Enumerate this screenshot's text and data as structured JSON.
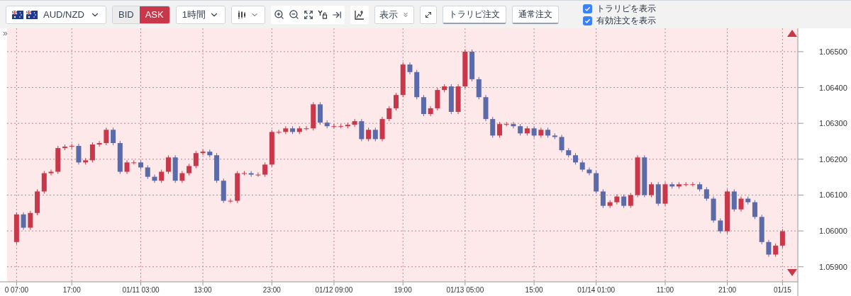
{
  "toolbar": {
    "symbol": {
      "label": "AUD/NZD"
    },
    "price_side": [
      {
        "label": "BID",
        "selected": false
      },
      {
        "label": "ASK",
        "selected": true
      }
    ],
    "timeframe": {
      "label": "1時間"
    },
    "display_menu": {
      "label": "表示"
    },
    "order_buttons": [
      "トラリピ注文",
      "通常注文"
    ],
    "checkboxes": [
      {
        "label": "トラリピを表示",
        "checked": true
      },
      {
        "label": "有効注文を表示",
        "checked": true
      }
    ]
  },
  "chart": {
    "panel_toggle": "»",
    "chart_data": {
      "type": "candlestick",
      "grid": true,
      "ylim": [
        1.05858,
        1.06565
      ],
      "yticks": [
        {
          "value": 1.065,
          "label": "1.06500"
        },
        {
          "value": 1.064,
          "label": "1.06400"
        },
        {
          "value": 1.063,
          "label": "1.06300"
        },
        {
          "value": 1.062,
          "label": "1.06200"
        },
        {
          "value": 1.061,
          "label": "1.06100"
        },
        {
          "value": 1.06,
          "label": "1.06000"
        },
        {
          "value": 1.059,
          "label": "1.05900"
        }
      ],
      "categories": [
        "0 07:00",
        null,
        null,
        null,
        null,
        null,
        null,
        null,
        "17:00",
        null,
        null,
        null,
        null,
        null,
        null,
        null,
        null,
        null,
        "01/11 03:00",
        null,
        null,
        null,
        null,
        null,
        null,
        null,
        null,
        "13:00",
        null,
        null,
        null,
        null,
        null,
        null,
        null,
        null,
        null,
        "23:00",
        null,
        null,
        null,
        null,
        null,
        null,
        null,
        null,
        "01/12 09:00",
        null,
        null,
        null,
        null,
        null,
        null,
        null,
        null,
        null,
        "19:00",
        null,
        null,
        null,
        null,
        null,
        null,
        null,
        null,
        "01/13 05:00",
        null,
        null,
        null,
        null,
        null,
        null,
        null,
        null,
        null,
        "15:00",
        null,
        null,
        null,
        null,
        null,
        null,
        null,
        null,
        "01/14 01:00",
        null,
        null,
        null,
        null,
        null,
        null,
        null,
        null,
        null,
        "11:00",
        null,
        null,
        null,
        null,
        null,
        null,
        null,
        null,
        "21:00",
        null,
        null,
        null,
        null,
        null,
        null,
        null,
        "01/15"
      ],
      "ohlc": [
        [
          1.05969,
          1.06052,
          1.05963,
          1.06046
        ],
        [
          1.06046,
          1.06052,
          1.06003,
          1.06009
        ],
        [
          1.06009,
          1.06056,
          1.06003,
          1.0605
        ],
        [
          1.0605,
          1.06116,
          1.06044,
          1.0611
        ],
        [
          1.0611,
          1.06167,
          1.06104,
          1.06161
        ],
        [
          1.06161,
          1.06171,
          1.06155,
          1.06165
        ],
        [
          1.06165,
          1.06237,
          1.06159,
          1.06231
        ],
        [
          1.06231,
          1.06241,
          1.06225,
          1.06235
        ],
        [
          1.06235,
          1.06243,
          1.06229,
          1.06237
        ],
        [
          1.06237,
          1.06243,
          1.06185,
          1.06191
        ],
        [
          1.06191,
          1.06203,
          1.06185,
          1.06197
        ],
        [
          1.06197,
          1.06247,
          1.06191,
          1.06241
        ],
        [
          1.06241,
          1.06251,
          1.06235,
          1.06245
        ],
        [
          1.06245,
          1.06288,
          1.06239,
          1.06282
        ],
        [
          1.06282,
          1.06288,
          1.06239,
          1.06245
        ],
        [
          1.06245,
          1.06251,
          1.06159,
          1.06165
        ],
        [
          1.06165,
          1.06197,
          1.06159,
          1.06191
        ],
        [
          1.06191,
          1.06197,
          1.06185,
          1.06191
        ],
        [
          1.06191,
          1.06197,
          1.06171,
          1.06177
        ],
        [
          1.06177,
          1.06183,
          1.06145,
          1.06151
        ],
        [
          1.06151,
          1.06157,
          1.06134,
          1.0614
        ],
        [
          1.0614,
          1.06171,
          1.06134,
          1.06165
        ],
        [
          1.06165,
          1.06211,
          1.06159,
          1.06205
        ],
        [
          1.06205,
          1.06211,
          1.06134,
          1.0614
        ],
        [
          1.0614,
          1.06167,
          1.06134,
          1.06161
        ],
        [
          1.06161,
          1.06187,
          1.06155,
          1.06181
        ],
        [
          1.06181,
          1.06223,
          1.06175,
          1.06217
        ],
        [
          1.06217,
          1.06227,
          1.06211,
          1.06221
        ],
        [
          1.06221,
          1.06227,
          1.06205,
          1.06211
        ],
        [
          1.06211,
          1.06217,
          1.06134,
          1.0614
        ],
        [
          1.0614,
          1.06146,
          1.06078,
          1.06084
        ],
        [
          1.06084,
          1.0609,
          1.06078,
          1.06084
        ],
        [
          1.06084,
          1.06167,
          1.06078,
          1.06161
        ],
        [
          1.06161,
          1.06167,
          1.06155,
          1.06161
        ],
        [
          1.06161,
          1.06167,
          1.06151,
          1.06157
        ],
        [
          1.06157,
          1.06163,
          1.06151,
          1.06157
        ],
        [
          1.06157,
          1.06191,
          1.06151,
          1.06185
        ],
        [
          1.06185,
          1.06282,
          1.06179,
          1.06276
        ],
        [
          1.06276,
          1.06282,
          1.0627,
          1.06276
        ],
        [
          1.06276,
          1.06292,
          1.0627,
          1.06286
        ],
        [
          1.06286,
          1.06292,
          1.0627,
          1.06276
        ],
        [
          1.06276,
          1.06292,
          1.0627,
          1.06286
        ],
        [
          1.06286,
          1.06292,
          1.0628,
          1.06286
        ],
        [
          1.06286,
          1.06359,
          1.0628,
          1.06353
        ],
        [
          1.06353,
          1.06359,
          1.06296,
          1.06302
        ],
        [
          1.06302,
          1.06308,
          1.06286,
          1.06292
        ],
        [
          1.06292,
          1.06298,
          1.06286,
          1.06292
        ],
        [
          1.06292,
          1.06298,
          1.06286,
          1.06292
        ],
        [
          1.06292,
          1.06302,
          1.06286,
          1.06296
        ],
        [
          1.06296,
          1.06312,
          1.0629,
          1.06306
        ],
        [
          1.06306,
          1.06312,
          1.0625,
          1.06256
        ],
        [
          1.06256,
          1.06288,
          1.0625,
          1.06282
        ],
        [
          1.06282,
          1.06288,
          1.0625,
          1.06256
        ],
        [
          1.06256,
          1.06318,
          1.0625,
          1.06312
        ],
        [
          1.06312,
          1.06348,
          1.06306,
          1.06342
        ],
        [
          1.06342,
          1.06385,
          1.06336,
          1.06379
        ],
        [
          1.06379,
          1.0647,
          1.06373,
          1.06464
        ],
        [
          1.06464,
          1.0647,
          1.06437,
          1.06443
        ],
        [
          1.06443,
          1.06449,
          1.06367,
          1.06373
        ],
        [
          1.06373,
          1.06379,
          1.0632,
          1.06326
        ],
        [
          1.06326,
          1.06348,
          1.0632,
          1.06342
        ],
        [
          1.06342,
          1.06399,
          1.06336,
          1.06393
        ],
        [
          1.06393,
          1.06409,
          1.06387,
          1.06403
        ],
        [
          1.06403,
          1.06409,
          1.06326,
          1.06332
        ],
        [
          1.06332,
          1.06409,
          1.06326,
          1.06403
        ],
        [
          1.06403,
          1.06506,
          1.06397,
          1.065
        ],
        [
          1.065,
          1.06506,
          1.06417,
          1.06423
        ],
        [
          1.06423,
          1.06429,
          1.06367,
          1.06373
        ],
        [
          1.06373,
          1.06379,
          1.06306,
          1.06312
        ],
        [
          1.06312,
          1.06318,
          1.0626,
          1.06266
        ],
        [
          1.06266,
          1.06304,
          1.0626,
          1.06298
        ],
        [
          1.06298,
          1.06304,
          1.06292,
          1.06298
        ],
        [
          1.06298,
          1.06304,
          1.06286,
          1.06292
        ],
        [
          1.06292,
          1.06298,
          1.06266,
          1.06272
        ],
        [
          1.06272,
          1.06292,
          1.06266,
          1.06286
        ],
        [
          1.06286,
          1.06292,
          1.0626,
          1.06266
        ],
        [
          1.06266,
          1.06288,
          1.0626,
          1.06282
        ],
        [
          1.06282,
          1.06288,
          1.0626,
          1.06266
        ],
        [
          1.06266,
          1.06272,
          1.06256,
          1.06262
        ],
        [
          1.06262,
          1.06268,
          1.06219,
          1.06225
        ],
        [
          1.06225,
          1.06231,
          1.06205,
          1.06211
        ],
        [
          1.06211,
          1.06217,
          1.06185,
          1.06191
        ],
        [
          1.06191,
          1.06197,
          1.06165,
          1.06171
        ],
        [
          1.06171,
          1.06177,
          1.06155,
          1.06161
        ],
        [
          1.06161,
          1.06167,
          1.06104,
          1.0611
        ],
        [
          1.0611,
          1.06116,
          1.06064,
          1.0607
        ],
        [
          1.0607,
          1.06086,
          1.06064,
          1.0608
        ],
        [
          1.0608,
          1.06102,
          1.06074,
          1.06096
        ],
        [
          1.06096,
          1.06102,
          1.06064,
          1.0607
        ],
        [
          1.0607,
          1.06106,
          1.06064,
          1.061
        ],
        [
          1.061,
          1.06211,
          1.06094,
          1.06205
        ],
        [
          1.06205,
          1.06211,
          1.06094,
          1.061
        ],
        [
          1.061,
          1.06136,
          1.06094,
          1.0613
        ],
        [
          1.0613,
          1.06136,
          1.0607,
          1.06076
        ],
        [
          1.06076,
          1.06136,
          1.0607,
          1.0613
        ],
        [
          1.0613,
          1.06136,
          1.06118,
          1.06124
        ],
        [
          1.06124,
          1.06136,
          1.06118,
          1.0613
        ],
        [
          1.0613,
          1.06136,
          1.06124,
          1.0613
        ],
        [
          1.0613,
          1.06136,
          1.06124,
          1.0613
        ],
        [
          1.0613,
          1.06136,
          1.0611,
          1.06116
        ],
        [
          1.06116,
          1.06122,
          1.06084,
          1.0609
        ],
        [
          1.0609,
          1.06096,
          1.06023,
          1.06029
        ],
        [
          1.06029,
          1.06035,
          1.05993,
          1.05999
        ],
        [
          1.05999,
          1.06116,
          1.05993,
          1.0611
        ],
        [
          1.0611,
          1.06116,
          1.06054,
          1.0606
        ],
        [
          1.0606,
          1.06096,
          1.06054,
          1.0609
        ],
        [
          1.0609,
          1.06096,
          1.06074,
          1.0608
        ],
        [
          1.0608,
          1.06086,
          1.06033,
          1.06039
        ],
        [
          1.06039,
          1.06045,
          1.05963,
          1.05969
        ],
        [
          1.05969,
          1.05975,
          1.05928,
          1.05934
        ],
        [
          1.05934,
          1.05965,
          1.05928,
          1.05959
        ],
        [
          1.05959,
          1.06005,
          1.05953,
          1.05999
        ]
      ]
    }
  }
}
